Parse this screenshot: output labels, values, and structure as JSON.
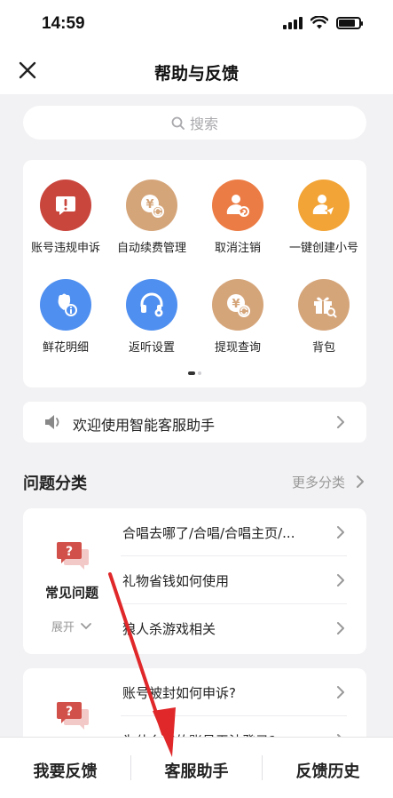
{
  "status_bar": {
    "time": "14:59"
  },
  "header": {
    "title": "帮助与反馈"
  },
  "search": {
    "placeholder": "搜索"
  },
  "quick_grid": {
    "items": [
      {
        "label": "账号违规申诉",
        "icon": "exclamation-icon",
        "color": "#c9463d"
      },
      {
        "label": "自动续费管理",
        "icon": "yen-renew-icon",
        "color": "#d5a57a"
      },
      {
        "label": "取消注销",
        "icon": "user-undo-icon",
        "color": "#ec7c45"
      },
      {
        "label": "一键创建小号",
        "icon": "user-send-icon",
        "color": "#f2a436"
      },
      {
        "label": "鲜花明细",
        "icon": "flower-info-icon",
        "color": "#4f8ff0"
      },
      {
        "label": "返听设置",
        "icon": "headphone-gear-icon",
        "color": "#4f8ff0"
      },
      {
        "label": "提现查询",
        "icon": "yen-renew-icon",
        "color": "#d5a57a"
      },
      {
        "label": "背包",
        "icon": "gift-search-icon",
        "color": "#d5a57a"
      }
    ],
    "page_index": 1,
    "page_count": 2
  },
  "assistant_banner": {
    "text": "欢迎使用智能客服助手"
  },
  "problem_section": {
    "title": "问题分类",
    "more_label": "更多分类"
  },
  "category_cards": [
    {
      "name": "常见问题",
      "expand_label": "展开",
      "questions": [
        "合唱去哪了/合唱/合唱主页/...",
        "礼物省钱如何使用",
        "狼人杀游戏相关"
      ]
    },
    {
      "name": "",
      "expand_label": "",
      "questions": [
        "账号被封如何申诉?",
        "为什么我的账号无法登录?"
      ]
    }
  ],
  "tabbar": {
    "feedback_label": "我要反馈",
    "assistant_label": "客服助手",
    "history_label": "反馈历史"
  },
  "colors": {
    "annotation_arrow": "#e0282a",
    "page_bg": "#f2f2f4"
  }
}
